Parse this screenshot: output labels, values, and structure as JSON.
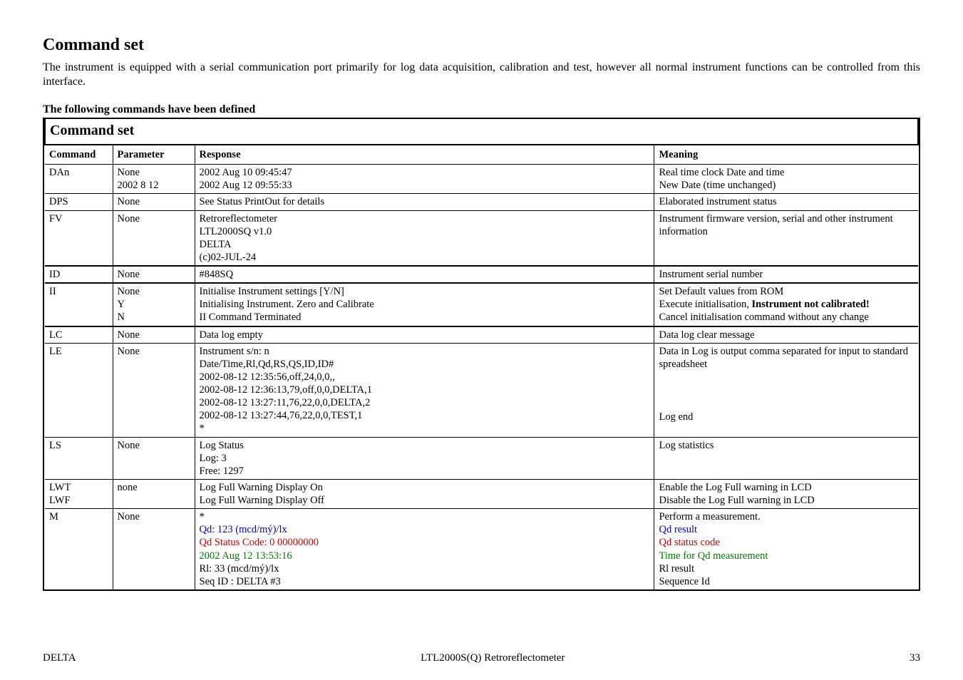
{
  "section_title": "Command set",
  "intro": "The instrument is equipped with a serial communication port primarily for log data acquisition, calibration and test, however all normal instrument functions can be controlled from this interface.",
  "subhead": "The following commands have been defined",
  "table": {
    "title": "Command set",
    "headers": {
      "h1": "Command",
      "h2": "Parameter",
      "h3": "Response",
      "h4": "Meaning"
    },
    "rows": {
      "DAn": {
        "cmd": "DAn",
        "param": "None\n2002 8 12",
        "resp": "2002 Aug 10 09:45:47\n2002 Aug 12 09:55:33",
        "mean": "Real time clock Date and time\nNew Date (time unchanged)"
      },
      "DPS": {
        "cmd": "DPS",
        "param": "None",
        "resp": "See Status PrintOut for details",
        "mean": "Elaborated instrument status"
      },
      "FV": {
        "cmd": "FV",
        "param": "None",
        "resp": "Retroreflectometer\nLTL2000SQ v1.0\nDELTA\n(c)02-JUL-24",
        "mean": "Instrument firmware version, serial and other instrument information"
      },
      "ID": {
        "cmd": "ID",
        "param": "None",
        "resp": "#848SQ",
        "mean": "Instrument serial number"
      },
      "II": {
        "cmd": "II",
        "param": "None\nY\nN",
        "resp": "Initialise Instrument settings [Y/N]\nInitialising Instrument. Zero and Calibrate\nII Command Terminated",
        "mean_l1": "Set Default values from ROM",
        "mean_l2a": "Execute initialisation, ",
        "mean_l2b": "Instrument not calibrated!",
        "mean_l3": "Cancel initialisation command without any change"
      },
      "LC": {
        "cmd": "LC",
        "param": "None",
        "resp": "Data log empty",
        "mean": "Data log clear message"
      },
      "LE": {
        "cmd": "LE",
        "param": "None",
        "resp": "Instrument s/n: n\nDate/Time,Rl,Qd,RS,QS,ID,ID#\n2002-08-12 12:35:56,off,24,0,0,,\n2002-08-12 12:36:13,79,off,0,0,DELTA,1\n2002-08-12 13:27:11,76,22,0,0,DELTA,2\n2002-08-12 13:27:44,76,22,0,0,TEST,1\n*",
        "mean": "Data in  Log is output comma separated for input to standard spreadsheet",
        "mean_end": "Log end"
      },
      "LS": {
        "cmd": "LS",
        "param": "None",
        "resp": "Log Status\nLog:   3\nFree: 1297",
        "mean": "Log statistics"
      },
      "LWT": {
        "cmd": "LWT",
        "resp": "Log Full Warning Display On",
        "mean": "Enable the Log Full warning in LCD"
      },
      "LWF": {
        "cmd": "LWF",
        "param_shared": "none",
        "resp": "Log Full Warning Display Off",
        "mean": "Disable the Log Full warning in LCD"
      },
      "M": {
        "cmd": "M",
        "param": "None",
        "resp_star": "*",
        "resp_qd": "Qd: 123 (mcd/mý)/lx",
        "resp_qdstat": "Qd Status Code: 0 00000000",
        "resp_time": "2002 Aug 12 13:53:16",
        "resp_rl": "Rl:  33 (mcd/mý)/lx",
        "resp_seq": "Seq ID : DELTA  #3",
        "mean_1": "Perform a measurement.",
        "mean_2": "Qd result",
        "mean_3": "Qd status code",
        "mean_4": "Time for Qd measurement",
        "mean_5": "Rl result",
        "mean_6": "Sequence Id"
      }
    }
  },
  "footer": {
    "left": "DELTA",
    "center": "LTL2000S(Q) Retroreflectometer",
    "right": "33"
  }
}
